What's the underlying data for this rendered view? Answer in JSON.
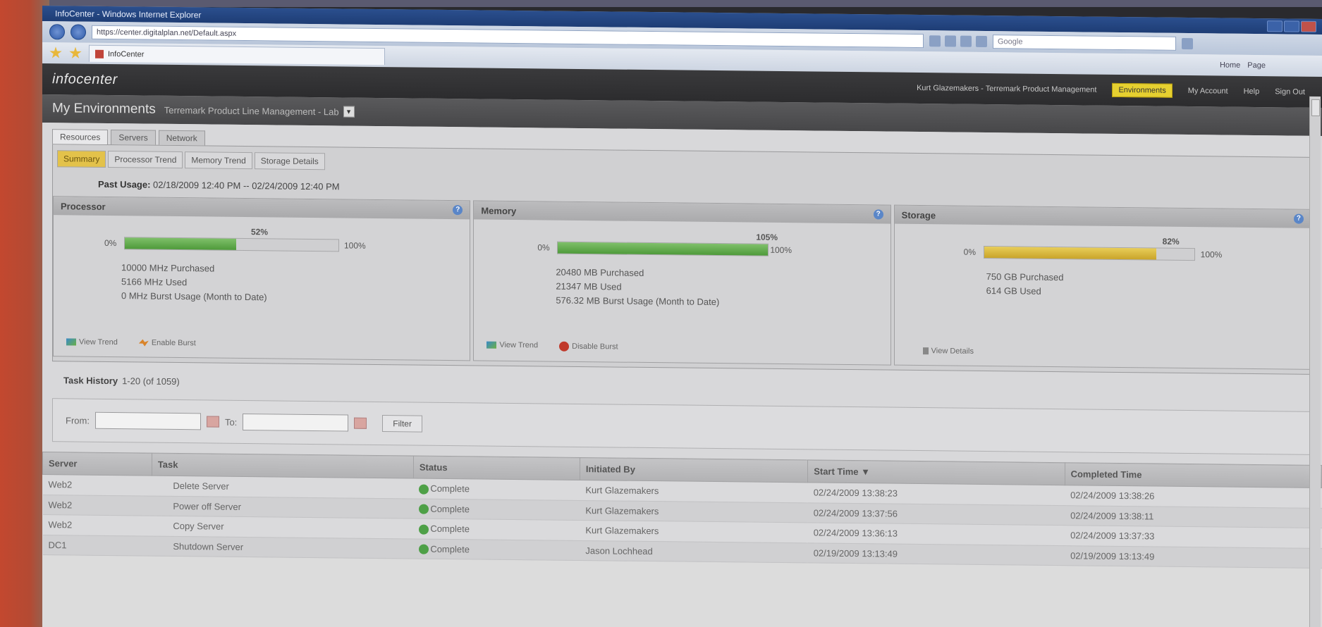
{
  "browser": {
    "title": "InfoCenter - Windows Internet Explorer",
    "url": "https://center.digitalplan.net/Default.aspx",
    "search_placeholder": "Google",
    "tab_label": "InfoCenter",
    "tools": [
      "Home",
      "Page"
    ]
  },
  "app": {
    "logo": "infocenter",
    "user_text": "Kurt Glazemakers - Terremark Product Management",
    "environments_button": "Environments",
    "my_account": "My Account",
    "help": "Help",
    "sign_out": "Sign Out"
  },
  "subheader": {
    "title": "My Environments",
    "environment": "Terremark Product Line Management - Lab"
  },
  "top_tabs": [
    "Resources",
    "Servers",
    "Network"
  ],
  "sub_tabs": [
    "Summary",
    "Processor Trend",
    "Memory Trend",
    "Storage Details"
  ],
  "past_usage": {
    "label": "Past Usage:",
    "range": "02/18/2009 12:40 PM -- 02/24/2009 12:40 PM"
  },
  "cards": {
    "processor": {
      "title": "Processor",
      "percent_label": "52%",
      "percent": 52,
      "min": "0%",
      "max": "100%",
      "line1": "10000 MHz Purchased",
      "line2": "5166 MHz Used",
      "line3": "0 MHz Burst Usage (Month to Date)",
      "link1": "View Trend",
      "link2": "Enable Burst"
    },
    "memory": {
      "title": "Memory",
      "percent_label": "105%",
      "percent": 100,
      "min": "0%",
      "max": "100%",
      "line1": "20480 MB Purchased",
      "line2": "21347 MB Used",
      "line3": "576.32 MB Burst Usage (Month to Date)",
      "link1": "View Trend",
      "link2": "Disable Burst"
    },
    "storage": {
      "title": "Storage",
      "percent_label": "82%",
      "percent": 82,
      "min": "0%",
      "max": "100%",
      "line1": "750 GB Purchased",
      "line2": "614 GB Used",
      "link1": "View Details"
    }
  },
  "task_history": {
    "label": "Task History",
    "range": "1-20 (of 1059)"
  },
  "filter": {
    "from_label": "From:",
    "to_label": "To:",
    "button": "Filter"
  },
  "table": {
    "headers": [
      "Server",
      "Task",
      "Status",
      "Initiated By",
      "Start Time ▼",
      "Completed Time"
    ],
    "rows": [
      [
        "Web2",
        "Delete Server",
        "Complete",
        "Kurt Glazemakers",
        "02/24/2009 13:38:23",
        "02/24/2009 13:38:26"
      ],
      [
        "Web2",
        "Power off Server",
        "Complete",
        "Kurt Glazemakers",
        "02/24/2009 13:37:56",
        "02/24/2009 13:38:11"
      ],
      [
        "Web2",
        "Copy Server",
        "Complete",
        "Kurt Glazemakers",
        "02/24/2009 13:36:13",
        "02/24/2009 13:37:33"
      ],
      [
        "DC1",
        "Shutdown Server",
        "Complete",
        "Jason Lochhead",
        "02/19/2009 13:13:49",
        "02/19/2009 13:13:49"
      ]
    ]
  },
  "colors": {
    "green_fill": "#4e9a3a",
    "yellow_fill": "#c9a42a",
    "accent_tab": "#e3c24a",
    "header_dark": "#2c2c2e"
  }
}
